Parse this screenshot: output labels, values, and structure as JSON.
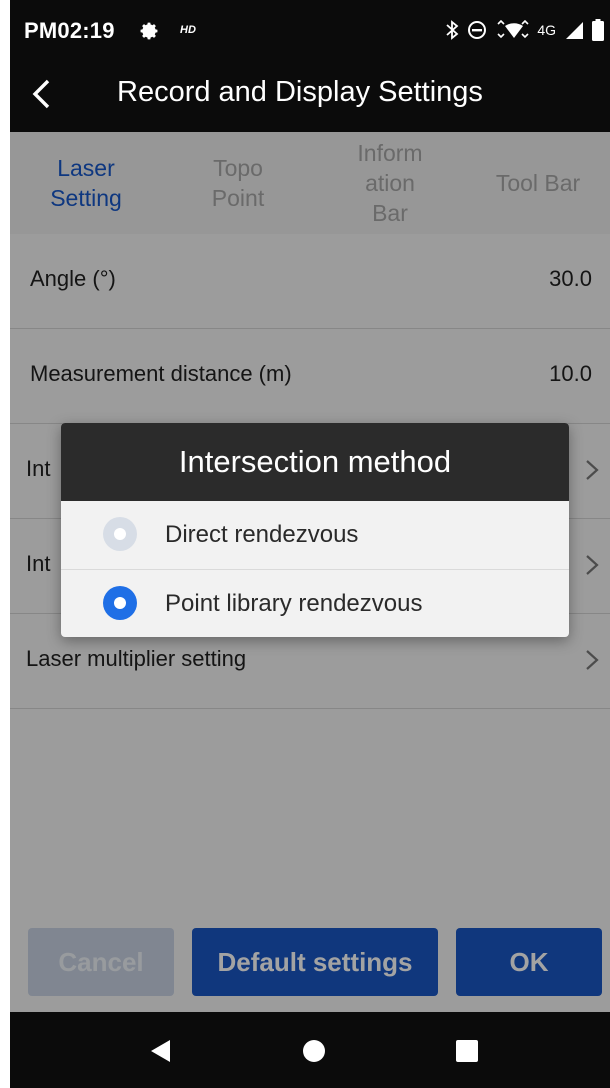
{
  "status": {
    "time": "PM02:19",
    "hd": "HD",
    "network": "4G",
    "icons": [
      "gear-icon",
      "bluetooth-icon",
      "do-not-disturb-icon",
      "wifi-icon",
      "cell-signal-icon",
      "battery-icon"
    ]
  },
  "header": {
    "title": "Record and Display Settings",
    "back_icon": "chevron-left-icon"
  },
  "tabs": [
    {
      "lines": [
        "Laser",
        "Setting"
      ],
      "active": true
    },
    {
      "lines": [
        "Topo",
        "Point"
      ],
      "active": false
    },
    {
      "lines": [
        "Inform",
        "ation",
        "Bar"
      ],
      "active": false
    },
    {
      "lines": [
        "Tool Bar"
      ],
      "active": false
    }
  ],
  "rows": [
    {
      "label": "Angle (°)",
      "value": "30.0"
    },
    {
      "label": "Measurement distance (m)",
      "value": "10.0"
    },
    {
      "label": "Int",
      "value": ""
    },
    {
      "label": "Int",
      "value": ""
    },
    {
      "label": "Laser multiplier setting",
      "value": ""
    }
  ],
  "dialog": {
    "title": "Intersection method",
    "options": [
      {
        "label": "Direct rendezvous",
        "selected": false
      },
      {
        "label": "Point library rendezvous",
        "selected": true
      }
    ]
  },
  "buttons": {
    "cancel": "Cancel",
    "defaults": "Default settings",
    "ok": "OK"
  },
  "colors": {
    "accent": "#1f6fe6",
    "primary_button": "#1a56c4",
    "disabled_button": "#c8d2e3",
    "bar_background": "#0b0b0b"
  }
}
